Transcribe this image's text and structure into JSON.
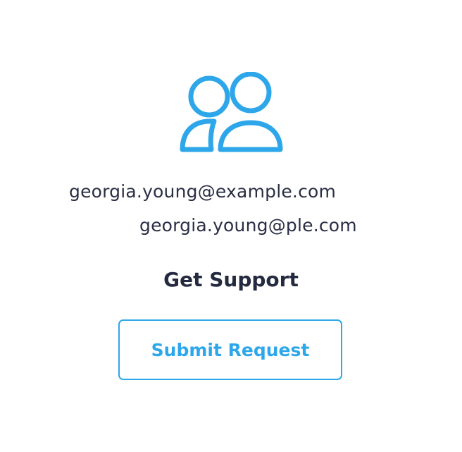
{
  "contact": {
    "icon": "users-icon",
    "email_primary": "georgia.young@example.com",
    "email_secondary": "georgia.young@ple.com"
  },
  "support": {
    "title": "Get Support",
    "submit_label": "Submit Request"
  },
  "colors": {
    "accent": "#2ea7ea",
    "text": "#2a2f45",
    "background": "#ffffff"
  }
}
